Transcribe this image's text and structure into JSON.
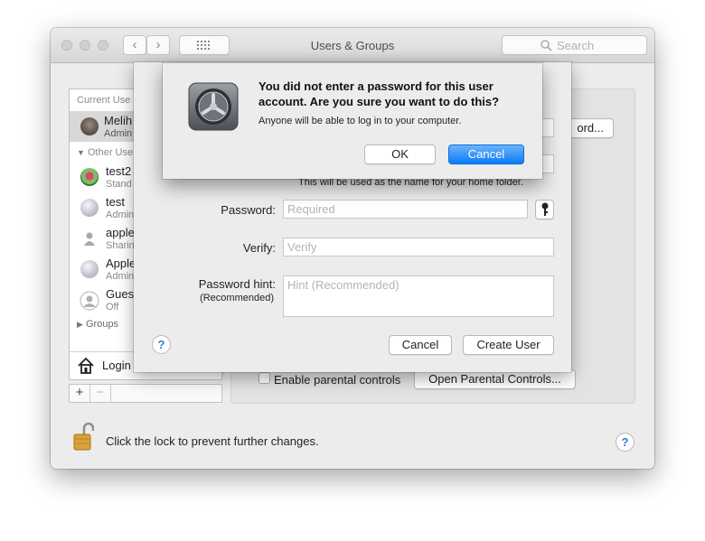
{
  "window": {
    "title": "Users & Groups",
    "search_placeholder": "Search",
    "grid_icon": "grid-icon"
  },
  "sidebar": {
    "section_current": "Current Use",
    "current_user": {
      "name": "Melih",
      "role": "Admin"
    },
    "section_other": "Other Use",
    "users": [
      {
        "name": "test2",
        "role": "Stand"
      },
      {
        "name": "test",
        "role": "Admin"
      },
      {
        "name": "apple",
        "role": "Sharin"
      },
      {
        "name": "Apple",
        "role": "Admin"
      },
      {
        "name": "Gues",
        "role": "Off"
      }
    ],
    "groups_label": "Groups",
    "login_label": "Login",
    "add_label": "+",
    "remove_label": "−"
  },
  "background_panel": {
    "password_button": "ord...",
    "parental_checkbox_label": "Enable parental controls",
    "open_parental_button": "Open Parental Controls..."
  },
  "new_user_sheet": {
    "home_folder_note": "This will be used as the name for your home folder.",
    "password_label": "Password:",
    "password_placeholder": "Required",
    "verify_label": "Verify:",
    "verify_placeholder": "Verify",
    "hint_label": "Password hint:",
    "hint_sublabel": "(Recommended)",
    "hint_placeholder": "Hint (Recommended)",
    "help_label": "?",
    "cancel_button": "Cancel",
    "create_button": "Create User"
  },
  "alert": {
    "title": "You did not enter a password for this user account. Are you sure you want to do this?",
    "message": "Anyone will be able to log in to your computer.",
    "ok_button": "OK",
    "cancel_button": "Cancel"
  },
  "footer": {
    "lock_text": "Click the lock to prevent further changes.",
    "help_label": "?"
  },
  "colors": {
    "accent": "#0a7bf5",
    "window_bg": "#ececec"
  }
}
